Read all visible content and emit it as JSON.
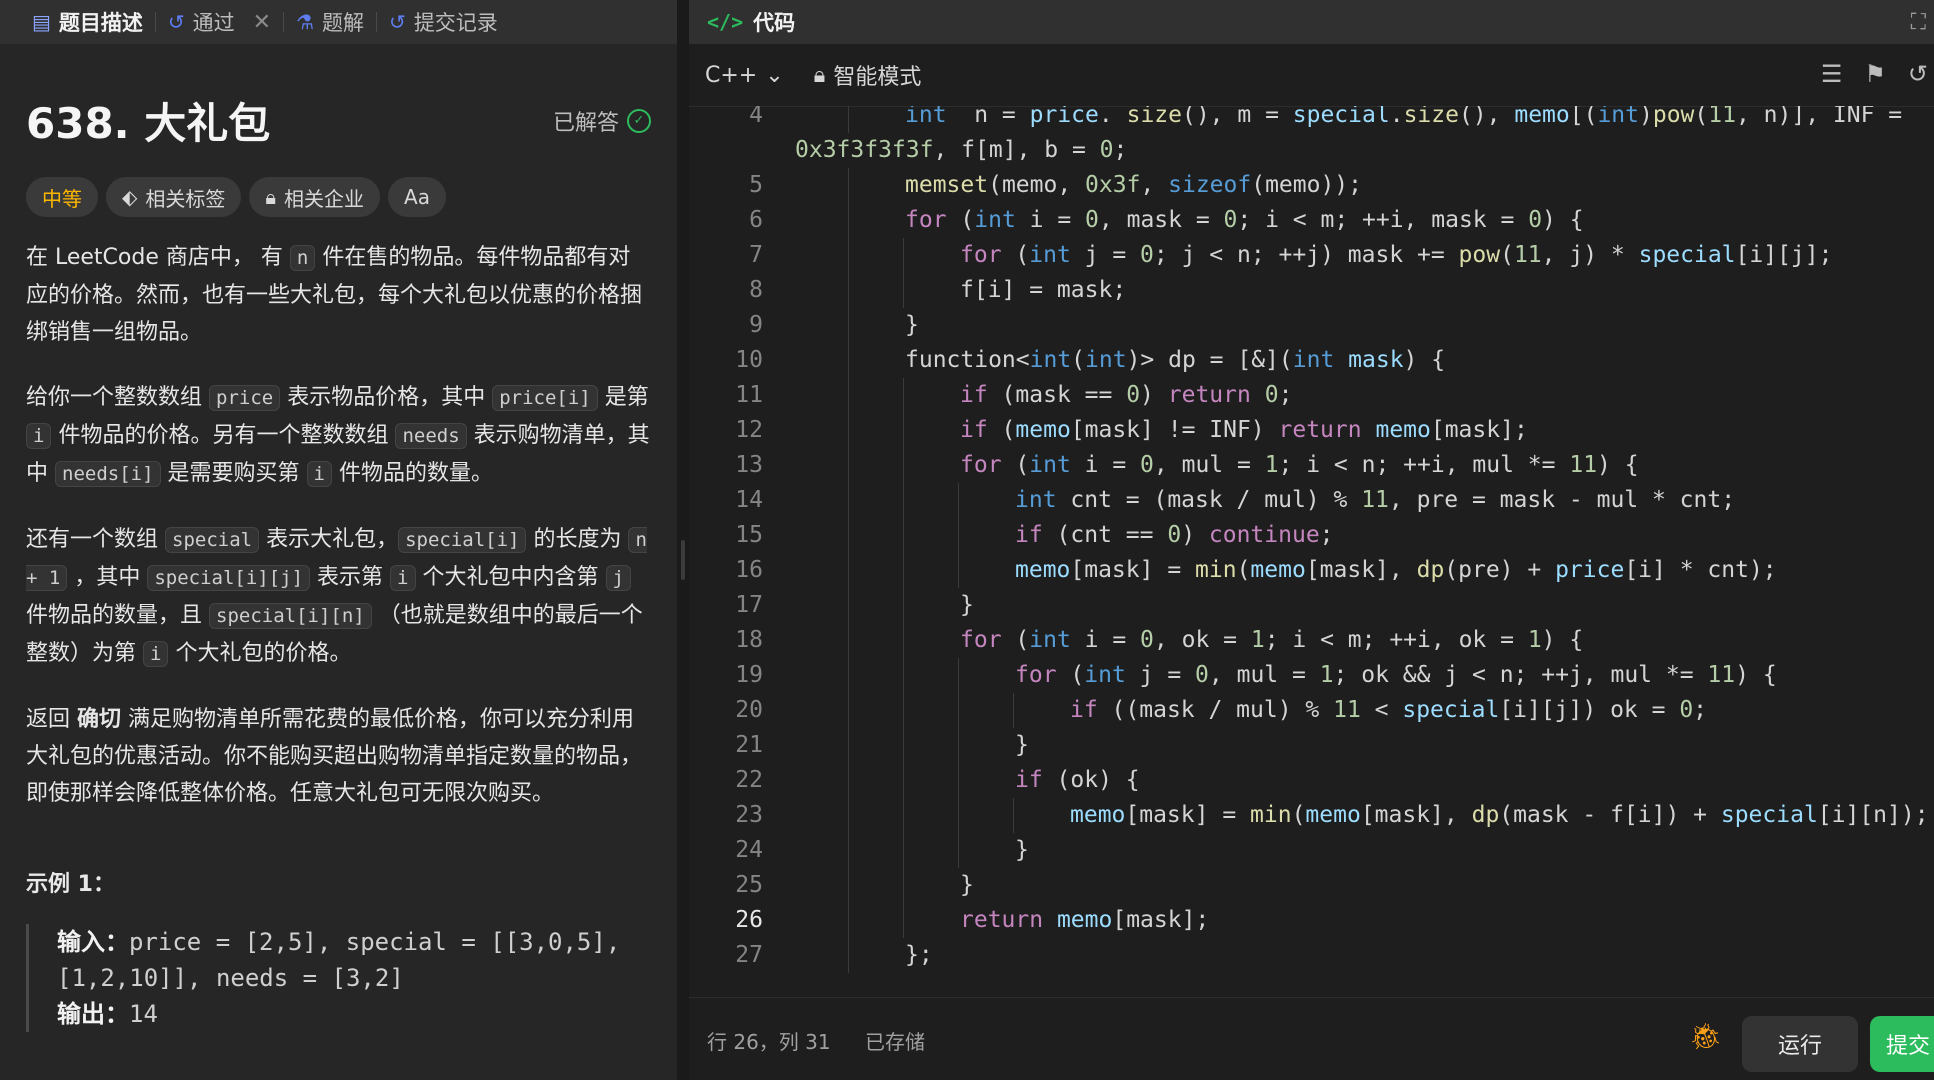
{
  "left_tabs": {
    "description": "题目描述",
    "passed": "通过",
    "solutions": "题解",
    "submissions": "提交记录"
  },
  "problem": {
    "title": "638. 大礼包",
    "status": "已解答",
    "difficulty": "中等",
    "tag_related": "相关标签",
    "tag_companies": "相关企业",
    "tag_font": "Aa",
    "p1": [
      {
        "t": "在 LeetCode 商店中， 有 "
      },
      {
        "c": "n"
      },
      {
        "t": " 件在售的物品。每件物品都有对应的价格。然而，也有一些大礼包，每个大礼包以优惠的价格捆绑销售一组物品。"
      }
    ],
    "p2": [
      {
        "t": "给你一个整数数组 "
      },
      {
        "c": "price"
      },
      {
        "t": " 表示物品价格，其中 "
      },
      {
        "c": "price[i]"
      },
      {
        "t": " 是第 "
      },
      {
        "c": "i"
      },
      {
        "t": " 件物品的价格。另有一个整数数组 "
      },
      {
        "c": "needs"
      },
      {
        "t": " 表示购物清单，其中 "
      },
      {
        "c": "needs[i]"
      },
      {
        "t": " 是需要购买第 "
      },
      {
        "c": "i"
      },
      {
        "t": " 件物品的数量。"
      }
    ],
    "p3": [
      {
        "t": "还有一个数组 "
      },
      {
        "c": "special"
      },
      {
        "t": " 表示大礼包，"
      },
      {
        "c": "special[i]"
      },
      {
        "t": " 的长度为 "
      },
      {
        "c": "n + 1"
      },
      {
        "t": " ，其中 "
      },
      {
        "c": "special[i][j]"
      },
      {
        "t": " 表示第 "
      },
      {
        "c": "i"
      },
      {
        "t": " 个大礼包中内含第 "
      },
      {
        "c": "j"
      },
      {
        "t": " 件物品的数量，且 "
      },
      {
        "c": "special[i][n]"
      },
      {
        "t": " （也就是数组中的最后一个整数）为第 "
      },
      {
        "c": "i"
      },
      {
        "t": " 个大礼包的价格。"
      }
    ],
    "p4": [
      {
        "t": "返回 "
      },
      {
        "b": "确切"
      },
      {
        "t": " 满足购物清单所需花费的最低价格，你可以充分利用大礼包的优惠活动。你不能购买超出购物清单指定数量的物品，即使那样会降低整体价格。任意大礼包可无限次购买。"
      }
    ],
    "example_title": "示例 1：",
    "example_input_label": "输入：",
    "example_input": "price = [2,5], special = [[3,0,5],[1,2,10]], needs = [3,2]",
    "example_output_label": "输出：",
    "example_output": "14"
  },
  "editor": {
    "header": "代码",
    "language": "C++",
    "mode": "智能模式",
    "current_line": 26,
    "lines": [
      {
        "n": "4",
        "ind": 2,
        "toks": [
          [
            "ty",
            "int"
          ],
          [
            "",
            "  n = "
          ],
          [
            "vr",
            "price"
          ],
          [
            "",
            ". "
          ],
          [
            "fn",
            "size"
          ],
          [
            "",
            "(), m = "
          ],
          [
            "vr",
            "special"
          ],
          [
            "",
            "."
          ],
          [
            "fn",
            "size"
          ],
          [
            "",
            "(), "
          ],
          [
            "vr",
            "memo"
          ],
          [
            "",
            "[("
          ],
          [
            "ty",
            "int"
          ],
          [
            "",
            ")"
          ],
          [
            "fn",
            "pow"
          ],
          [
            "",
            "("
          ],
          [
            "nm",
            "11"
          ],
          [
            "",
            ", n)], INF ="
          ]
        ]
      },
      {
        "n": "",
        "ind": 0,
        "toks": [
          [
            "nm",
            "0x3f3f3f3f"
          ],
          [
            "",
            ", f[m], b = "
          ],
          [
            "nm",
            "0"
          ],
          [
            "",
            ";"
          ]
        ]
      },
      {
        "n": "5",
        "ind": 2,
        "toks": [
          [
            "fn",
            "memset"
          ],
          [
            "",
            "(memo, "
          ],
          [
            "nm",
            "0x3f"
          ],
          [
            "",
            ", "
          ],
          [
            "ty",
            "sizeof"
          ],
          [
            "",
            "(memo));"
          ]
        ]
      },
      {
        "n": "6",
        "ind": 2,
        "toks": [
          [
            "kw",
            "for"
          ],
          [
            "",
            " ("
          ],
          [
            "ty",
            "int"
          ],
          [
            "",
            " i = "
          ],
          [
            "nm",
            "0"
          ],
          [
            "",
            ", mask = "
          ],
          [
            "nm",
            "0"
          ],
          [
            "",
            "; i < m; ++i, mask = "
          ],
          [
            "nm",
            "0"
          ],
          [
            "",
            ") {"
          ]
        ]
      },
      {
        "n": "7",
        "ind": 3,
        "toks": [
          [
            "kw",
            "for"
          ],
          [
            "",
            " ("
          ],
          [
            "ty",
            "int"
          ],
          [
            "",
            " j = "
          ],
          [
            "nm",
            "0"
          ],
          [
            "",
            "; j < n; ++j) mask += "
          ],
          [
            "fn",
            "pow"
          ],
          [
            "",
            "("
          ],
          [
            "nm",
            "11"
          ],
          [
            "",
            ", j) * "
          ],
          [
            "vr",
            "special"
          ],
          [
            "",
            "[i][j];"
          ]
        ]
      },
      {
        "n": "8",
        "ind": 3,
        "toks": [
          [
            "",
            "f[i] = mask;"
          ]
        ]
      },
      {
        "n": "9",
        "ind": 2,
        "toks": [
          [
            "",
            "}"
          ]
        ]
      },
      {
        "n": "10",
        "ind": 2,
        "toks": [
          [
            "",
            "function<"
          ],
          [
            "ty",
            "int"
          ],
          [
            "",
            "("
          ],
          [
            "ty",
            "int"
          ],
          [
            "",
            ")> dp = [&]("
          ],
          [
            "ty",
            "int"
          ],
          [
            "",
            " "
          ],
          [
            "vr",
            "mask"
          ],
          [
            "",
            ") {"
          ]
        ]
      },
      {
        "n": "11",
        "ind": 3,
        "toks": [
          [
            "kw",
            "if"
          ],
          [
            "",
            "",
            " (mask == "
          ],
          [
            "nm",
            "0"
          ],
          [
            "",
            ") "
          ],
          [
            "kw",
            "return"
          ],
          [
            "",
            " "
          ],
          [
            "nm",
            "0"
          ],
          [
            "",
            ";"
          ]
        ]
      },
      {
        "n": "12",
        "ind": 3,
        "toks": [
          [
            "kw",
            "if"
          ],
          [
            "",
            " ("
          ],
          [
            "vr",
            "memo"
          ],
          [
            "",
            "[mask] != INF) "
          ],
          [
            "kw",
            "return"
          ],
          [
            "",
            " "
          ],
          [
            "vr",
            "memo"
          ],
          [
            "",
            "[mask];"
          ]
        ]
      },
      {
        "n": "13",
        "ind": 3,
        "toks": [
          [
            "kw",
            "for"
          ],
          [
            "",
            " ("
          ],
          [
            "ty",
            "int"
          ],
          [
            "",
            " i = "
          ],
          [
            "nm",
            "0"
          ],
          [
            "",
            ", mul = "
          ],
          [
            "nm",
            "1"
          ],
          [
            "",
            "; i < n; ++i, mul *= "
          ],
          [
            "nm",
            "11"
          ],
          [
            "",
            ") {"
          ]
        ]
      },
      {
        "n": "14",
        "ind": 4,
        "toks": [
          [
            "ty",
            "int"
          ],
          [
            "",
            " cnt = (mask / mul) % "
          ],
          [
            "nm",
            "11"
          ],
          [
            "",
            ", pre = mask - mul * cnt;"
          ]
        ]
      },
      {
        "n": "15",
        "ind": 4,
        "toks": [
          [
            "kw",
            "if"
          ],
          [
            "",
            " (cnt == "
          ],
          [
            "nm",
            "0"
          ],
          [
            "",
            ") "
          ],
          [
            "kw",
            "continue"
          ],
          [
            "",
            ";"
          ]
        ]
      },
      {
        "n": "16",
        "ind": 4,
        "toks": [
          [
            "vr",
            "memo"
          ],
          [
            "",
            "[mask] = "
          ],
          [
            "fn",
            "min"
          ],
          [
            "",
            "("
          ],
          [
            "vr",
            "memo"
          ],
          [
            "",
            "[mask], "
          ],
          [
            "fn",
            "dp"
          ],
          [
            "",
            "(pre) + "
          ],
          [
            "vr",
            "price"
          ],
          [
            "",
            "[i] * cnt);"
          ]
        ]
      },
      {
        "n": "17",
        "ind": 3,
        "toks": [
          [
            "",
            "}"
          ]
        ]
      },
      {
        "n": "18",
        "ind": 3,
        "toks": [
          [
            "kw",
            "for"
          ],
          [
            "",
            " ("
          ],
          [
            "ty",
            "int"
          ],
          [
            "",
            " i = "
          ],
          [
            "nm",
            "0"
          ],
          [
            "",
            ", ok = "
          ],
          [
            "nm",
            "1"
          ],
          [
            "",
            "; i < m; ++i, ok = "
          ],
          [
            "nm",
            "1"
          ],
          [
            "",
            ") {"
          ]
        ]
      },
      {
        "n": "19",
        "ind": 4,
        "toks": [
          [
            "kw",
            "for"
          ],
          [
            "",
            " ("
          ],
          [
            "ty",
            "int"
          ],
          [
            "",
            " j = "
          ],
          [
            "nm",
            "0"
          ],
          [
            "",
            ", mul = "
          ],
          [
            "nm",
            "1"
          ],
          [
            "",
            "; ok && j < n; ++j, mul *= "
          ],
          [
            "nm",
            "11"
          ],
          [
            "",
            ") {"
          ]
        ]
      },
      {
        "n": "20",
        "ind": 5,
        "toks": [
          [
            "kw",
            "if"
          ],
          [
            "",
            " ((mask / mul) % "
          ],
          [
            "nm",
            "11"
          ],
          [
            "",
            " < "
          ],
          [
            "vr",
            "special"
          ],
          [
            "",
            "[i][j]) ok = "
          ],
          [
            "nm",
            "0"
          ],
          [
            "",
            ";"
          ]
        ]
      },
      {
        "n": "21",
        "ind": 4,
        "toks": [
          [
            "",
            "}"
          ]
        ]
      },
      {
        "n": "22",
        "ind": 4,
        "toks": [
          [
            "kw",
            "if"
          ],
          [
            "",
            " (ok) {"
          ]
        ]
      },
      {
        "n": "23",
        "ind": 5,
        "toks": [
          [
            "vr",
            "memo"
          ],
          [
            "",
            "[mask] = "
          ],
          [
            "fn",
            "min"
          ],
          [
            "",
            "("
          ],
          [
            "vr",
            "memo"
          ],
          [
            "",
            "[mask], "
          ],
          [
            "fn",
            "dp"
          ],
          [
            "",
            "(mask - f[i]) + "
          ],
          [
            "vr",
            "special"
          ],
          [
            "",
            "[i][n]);"
          ]
        ]
      },
      {
        "n": "24",
        "ind": 4,
        "toks": [
          [
            "",
            "}"
          ]
        ]
      },
      {
        "n": "25",
        "ind": 3,
        "toks": [
          [
            "",
            "}"
          ]
        ]
      },
      {
        "n": "26",
        "ind": 3,
        "toks": [
          [
            "kw",
            "return"
          ],
          [
            "",
            " "
          ],
          [
            "vr",
            "memo"
          ],
          [
            "",
            "[mask];"
          ]
        ]
      },
      {
        "n": "27",
        "ind": 2,
        "toks": [
          [
            "",
            "};"
          ]
        ]
      }
    ]
  },
  "status": {
    "position": "行 26，列 31",
    "saved": "已存储",
    "run": "运行",
    "submit": "提交"
  }
}
